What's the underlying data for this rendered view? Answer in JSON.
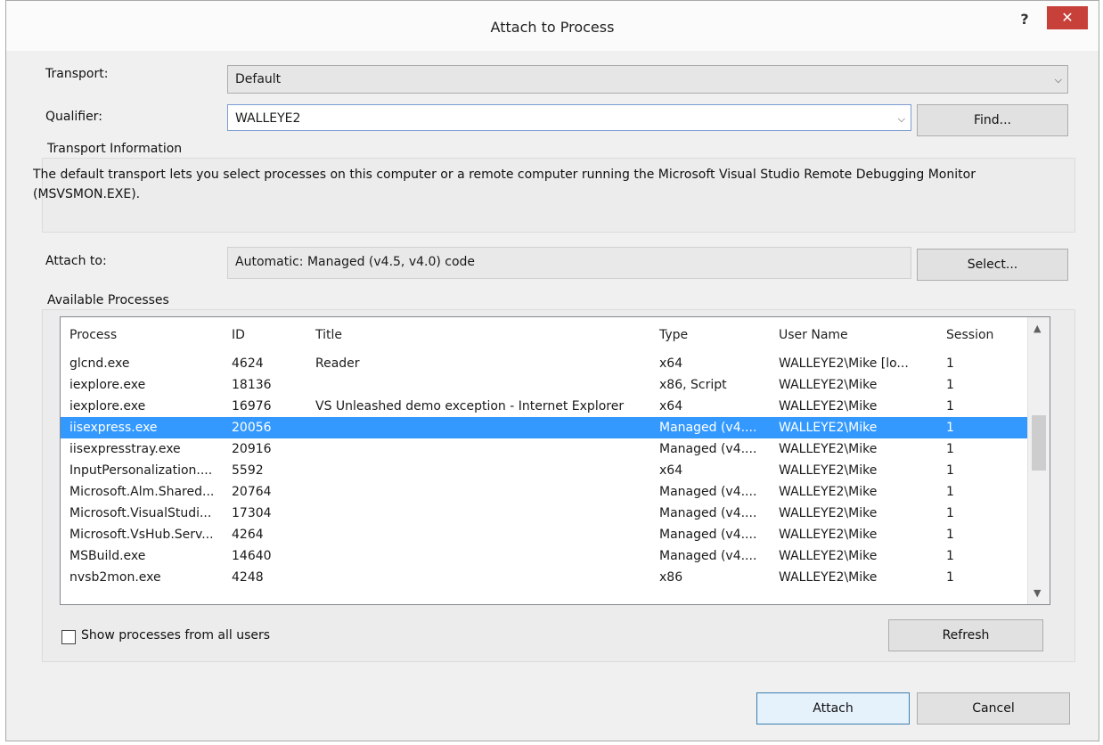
{
  "window": {
    "title": "Attach to Process",
    "help": "?",
    "close": "✕"
  },
  "transport": {
    "label": "Transport:",
    "value": "Default"
  },
  "qualifier": {
    "label": "Qualifier:",
    "value": "WALLEYE2",
    "find_label": "Find..."
  },
  "transport_info": {
    "heading": "Transport Information",
    "text": "The default transport lets you select processes on this computer or a remote computer running the Microsoft Visual Studio Remote Debugging Monitor (MSVSMON.EXE)."
  },
  "attach_to": {
    "label": "Attach to:",
    "value": "Automatic: Managed (v4.5, v4.0) code",
    "select_label": "Select..."
  },
  "processes": {
    "heading": "Available Processes",
    "columns": [
      "Process",
      "ID",
      "Title",
      "Type",
      "User Name",
      "Session"
    ],
    "rows": [
      [
        "glcnd.exe",
        "4624",
        "Reader",
        "x64",
        "WALLEYE2\\Mike [lo...",
        "1"
      ],
      [
        "iexplore.exe",
        "18136",
        "",
        "x86, Script",
        "WALLEYE2\\Mike",
        "1"
      ],
      [
        "iexplore.exe",
        "16976",
        "VS Unleashed demo exception - Internet Explorer",
        "x64",
        "WALLEYE2\\Mike",
        "1"
      ],
      [
        "iisexpress.exe",
        "20056",
        "",
        "Managed (v4....",
        "WALLEYE2\\Mike",
        "1"
      ],
      [
        "iisexpresstray.exe",
        "20916",
        "",
        "Managed (v4....",
        "WALLEYE2\\Mike",
        "1"
      ],
      [
        "InputPersonalization....",
        "5592",
        "",
        "x64",
        "WALLEYE2\\Mike",
        "1"
      ],
      [
        "Microsoft.Alm.Shared...",
        "20764",
        "",
        "Managed (v4....",
        "WALLEYE2\\Mike",
        "1"
      ],
      [
        "Microsoft.VisualStudi...",
        "17304",
        "",
        "Managed (v4....",
        "WALLEYE2\\Mike",
        "1"
      ],
      [
        "Microsoft.VsHub.Serv...",
        "4264",
        "",
        "Managed (v4....",
        "WALLEYE2\\Mike",
        "1"
      ],
      [
        "MSBuild.exe",
        "14640",
        "",
        "Managed (v4....",
        "WALLEYE2\\Mike",
        "1"
      ],
      [
        "nvsb2mon.exe",
        "4248",
        "",
        "x86",
        "WALLEYE2\\Mike",
        "1"
      ]
    ],
    "selected_index": 3,
    "show_all_label": "Show processes from all users",
    "refresh_label": "Refresh"
  },
  "footer": {
    "attach_label": "Attach",
    "cancel_label": "Cancel"
  },
  "colors": {
    "selection": "#3399ff",
    "close": "#c7403a"
  }
}
